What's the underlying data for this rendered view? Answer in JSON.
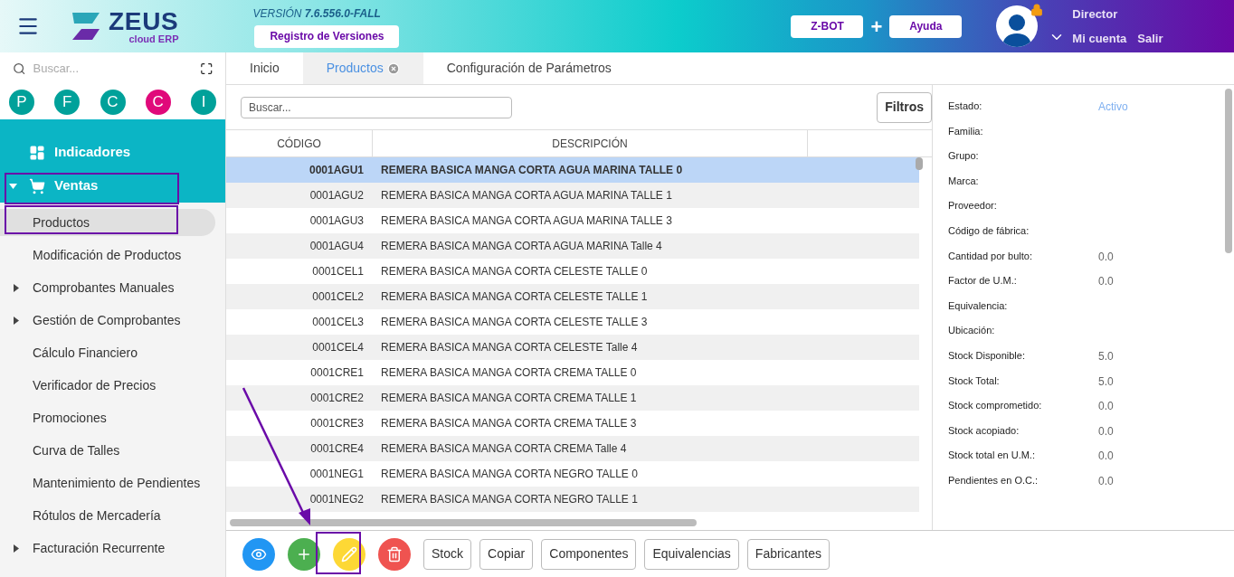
{
  "header": {
    "version_label": "VERSIÓN",
    "version_number": "7.6.556.0-FALL",
    "versions_button": "Registro de Versiones",
    "bot_button": "Z-BOT",
    "plus": "+",
    "help_button": "Ayuda",
    "user_role": "Director",
    "account_link": "Mi cuenta",
    "logout_link": "Salir",
    "logo_word": "ZEUS",
    "logo_sub": "cloud ERP"
  },
  "sidebar": {
    "search": {
      "placeholder": "Buscar..."
    },
    "shortcuts": [
      {
        "letter": "P",
        "color": "#00a19a"
      },
      {
        "letter": "F",
        "color": "#00a19a"
      },
      {
        "letter": "C",
        "color": "#00a19a"
      },
      {
        "letter": "C",
        "color": "#e0097a"
      },
      {
        "letter": "I",
        "color": "#00a19a"
      }
    ],
    "items": [
      {
        "label": "Indicadores",
        "kind": "section",
        "expanded": false,
        "selected": false
      },
      {
        "label": "Ventas",
        "kind": "section",
        "expanded": true,
        "selected": false
      },
      {
        "label": "Productos",
        "kind": "item",
        "selected": true
      },
      {
        "label": "Modificación de Productos",
        "kind": "item",
        "selected": false
      },
      {
        "label": "Comprobantes Manuales",
        "kind": "group",
        "selected": false
      },
      {
        "label": "Gestión de Comprobantes",
        "kind": "group",
        "selected": false
      },
      {
        "label": "Cálculo Financiero",
        "kind": "item",
        "selected": false
      },
      {
        "label": "Verificador de Precios",
        "kind": "item",
        "selected": false
      },
      {
        "label": "Promociones",
        "kind": "item",
        "selected": false
      },
      {
        "label": "Curva de Talles",
        "kind": "item",
        "selected": false
      },
      {
        "label": "Mantenimiento de Pendientes",
        "kind": "item",
        "selected": false
      },
      {
        "label": "Rótulos de Mercadería",
        "kind": "item",
        "selected": false
      },
      {
        "label": "Facturación Recurrente",
        "kind": "group",
        "selected": false
      }
    ]
  },
  "tabs": [
    {
      "label": "Inicio",
      "selected": false,
      "closable": false
    },
    {
      "label": "Productos",
      "selected": true,
      "closable": true
    },
    {
      "label": "Configuración de Parámetros",
      "selected": false,
      "closable": false
    }
  ],
  "search": {
    "placeholder": "Buscar..."
  },
  "filters_button": "Filtros",
  "table": {
    "columns": [
      "CÓDIGO",
      "DESCRIPCIÓN"
    ],
    "rows": [
      {
        "code": "0001AGU1",
        "description": "REMERA BASICA MANGA CORTA AGUA MARINA TALLE 0",
        "selected": true
      },
      {
        "code": "0001AGU2",
        "description": "REMERA BASICA MANGA CORTA AGUA MARINA TALLE 1",
        "selected": false
      },
      {
        "code": "0001AGU3",
        "description": "REMERA BASICA MANGA CORTA AGUA MARINA TALLE 3",
        "selected": false
      },
      {
        "code": "0001AGU4",
        "description": "REMERA BASICA MANGA CORTA AGUA MARINA Talle 4",
        "selected": false
      },
      {
        "code": "0001CEL1",
        "description": "REMERA BASICA MANGA CORTA CELESTE TALLE 0",
        "selected": false
      },
      {
        "code": "0001CEL2",
        "description": "REMERA BASICA MANGA CORTA CELESTE TALLE 1",
        "selected": false
      },
      {
        "code": "0001CEL3",
        "description": "REMERA BASICA MANGA CORTA CELESTE TALLE 3",
        "selected": false
      },
      {
        "code": "0001CEL4",
        "description": "REMERA BASICA MANGA CORTA CELESTE Talle 4",
        "selected": false
      },
      {
        "code": "0001CRE1",
        "description": "REMERA BASICA MANGA CORTA CREMA TALLE 0",
        "selected": false
      },
      {
        "code": "0001CRE2",
        "description": "REMERA BASICA MANGA CORTA CREMA TALLE 1",
        "selected": false
      },
      {
        "code": "0001CRE3",
        "description": "REMERA BASICA MANGA CORTA CREMA TALLE 3",
        "selected": false
      },
      {
        "code": "0001CRE4",
        "description": "REMERA BASICA MANGA CORTA CREMA Talle 4",
        "selected": false
      },
      {
        "code": "0001NEG1",
        "description": "REMERA BASICA MANGA CORTA NEGRO TALLE 0",
        "selected": false
      },
      {
        "code": "0001NEG2",
        "description": "REMERA BASICA MANGA CORTA NEGRO TALLE 1",
        "selected": false
      }
    ]
  },
  "details": [
    {
      "label": "Estado:",
      "value": "Activo",
      "kind": "status"
    },
    {
      "label": "Familia:"
    },
    {
      "label": "Grupo:"
    },
    {
      "label": "Marca:"
    },
    {
      "label": "Proveedor:"
    },
    {
      "label": "Código de fábrica:"
    },
    {
      "label": "Cantidad por bulto:",
      "value": "0.0",
      "kind": "number"
    },
    {
      "label": "Factor de U.M.:",
      "value": "0.0",
      "kind": "number"
    },
    {
      "label": "Equivalencia:"
    },
    {
      "label": "Ubicación:"
    },
    {
      "label": "Stock Disponible:",
      "value": "5.0",
      "kind": "number"
    },
    {
      "label": "Stock Total:",
      "value": "5.0",
      "kind": "number"
    },
    {
      "label": "Stock comprometido:",
      "value": "0.0",
      "kind": "number"
    },
    {
      "label": "Stock acopiado:",
      "value": "0.0",
      "kind": "number"
    },
    {
      "label": "Stock total en U.M.:",
      "value": "0.0",
      "kind": "number"
    },
    {
      "label": "Pendientes en O.C.:",
      "value": "0.0",
      "kind": "number"
    }
  ],
  "actions": [
    {
      "kind": "view",
      "color": "#2196f3"
    },
    {
      "kind": "add",
      "color": "#4caf50"
    },
    {
      "kind": "edit",
      "color": "#fdd835"
    },
    {
      "kind": "delete",
      "color": "#ef5350"
    }
  ],
  "buttons": [
    "Stock",
    "Copiar",
    "Componentes",
    "Equivalencias",
    "Fabricantes"
  ]
}
